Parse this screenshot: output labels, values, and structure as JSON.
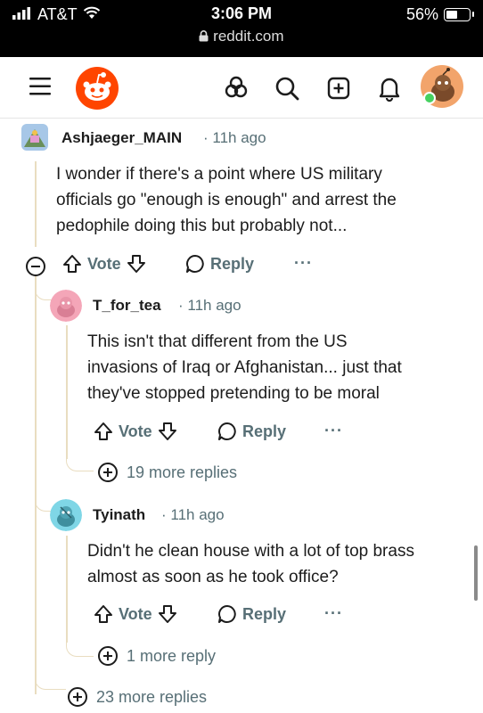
{
  "status_bar": {
    "carrier": "AT&T",
    "time": "3:06 PM",
    "url": "reddit.com",
    "battery": "56%",
    "battery_level": 0.56
  },
  "nav": {
    "icons": [
      "menu-icon",
      "reddit-logo",
      "popular-icon",
      "search-icon",
      "create-post-icon",
      "notifications-icon",
      "user-avatar"
    ]
  },
  "comments": [
    {
      "author": "Ashjaeger_MAIN",
      "time": "11h ago",
      "body_lines": [
        "I wonder if there's a point where US military",
        "officials go \"enough is enough\" and arrest the",
        "pedophile doing this but probably not..."
      ],
      "vote_label": "Vote",
      "reply_label": "Reply",
      "more_label": "···",
      "replies": [
        {
          "author": "T_for_tea",
          "time": "11h ago",
          "body_lines": [
            "This isn't that different from the US",
            "invasions of Iraq or Afghanistan... just that",
            "they've stopped pretending to be moral"
          ],
          "vote_label": "Vote",
          "reply_label": "Reply",
          "more_label": "···",
          "more_replies": "19 more replies"
        },
        {
          "author": "Tyinath",
          "time": "11h ago",
          "body_lines": [
            "Didn't he clean house with a lot of top brass",
            "almost as soon as he took office?"
          ],
          "vote_label": "Vote",
          "reply_label": "Reply",
          "more_label": "···",
          "more_replies": "1 more reply"
        }
      ],
      "more_replies": "23 more replies"
    }
  ],
  "colors": {
    "reddit_orange": "#ff4500",
    "thread_line": "#e9ddc0",
    "meta_gray": "#576f76"
  }
}
